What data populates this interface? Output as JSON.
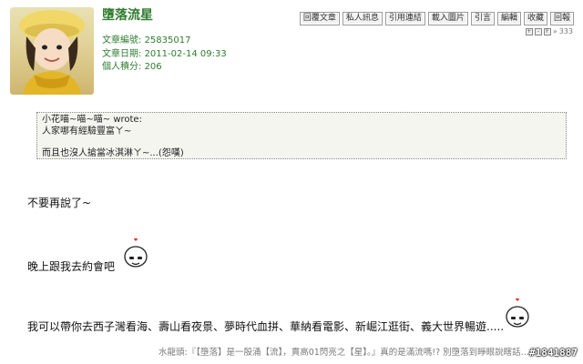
{
  "post": {
    "username": "墮落流星",
    "article_no_label": "文章編號:",
    "article_no": "25835017",
    "date_label": "文章日期:",
    "date": "2011-02-14 09:33",
    "points_label": "個人積分:",
    "points": "206"
  },
  "actions": {
    "reply": "回覆文章",
    "pm": "私人訊息",
    "quote_link": "引用連結",
    "load_image": "載入圖片",
    "quote": "引言",
    "edit": "編輯",
    "favorite": "收藏",
    "report": "回報"
  },
  "rating": {
    "score": "333"
  },
  "quote_block": {
    "header": "小花喵~喵~喵~ wrote:",
    "line1": "人家哪有經驗豐富ㄚ~",
    "line2": "而且也沒人搶當冰淇淋ㄚ~...(怨嘆)"
  },
  "body": {
    "p1": "不要再說了~",
    "p2": "晚上跟我去約會吧",
    "p3": "我可以帶你去西子灣看海、壽山看夜景、夢時代血拼、華納看電影、新崛江逛街、義大世界暢遊....."
  },
  "signature": "水龍頭:『【墮落】是一殷涌【流】，貫高01閃亮之【星】。』真的是滿流嗎!? 別墮落到睜眼說瞎話…",
  "watermark": "#1841887",
  "colors": {
    "accent": "#2f7c2f"
  }
}
